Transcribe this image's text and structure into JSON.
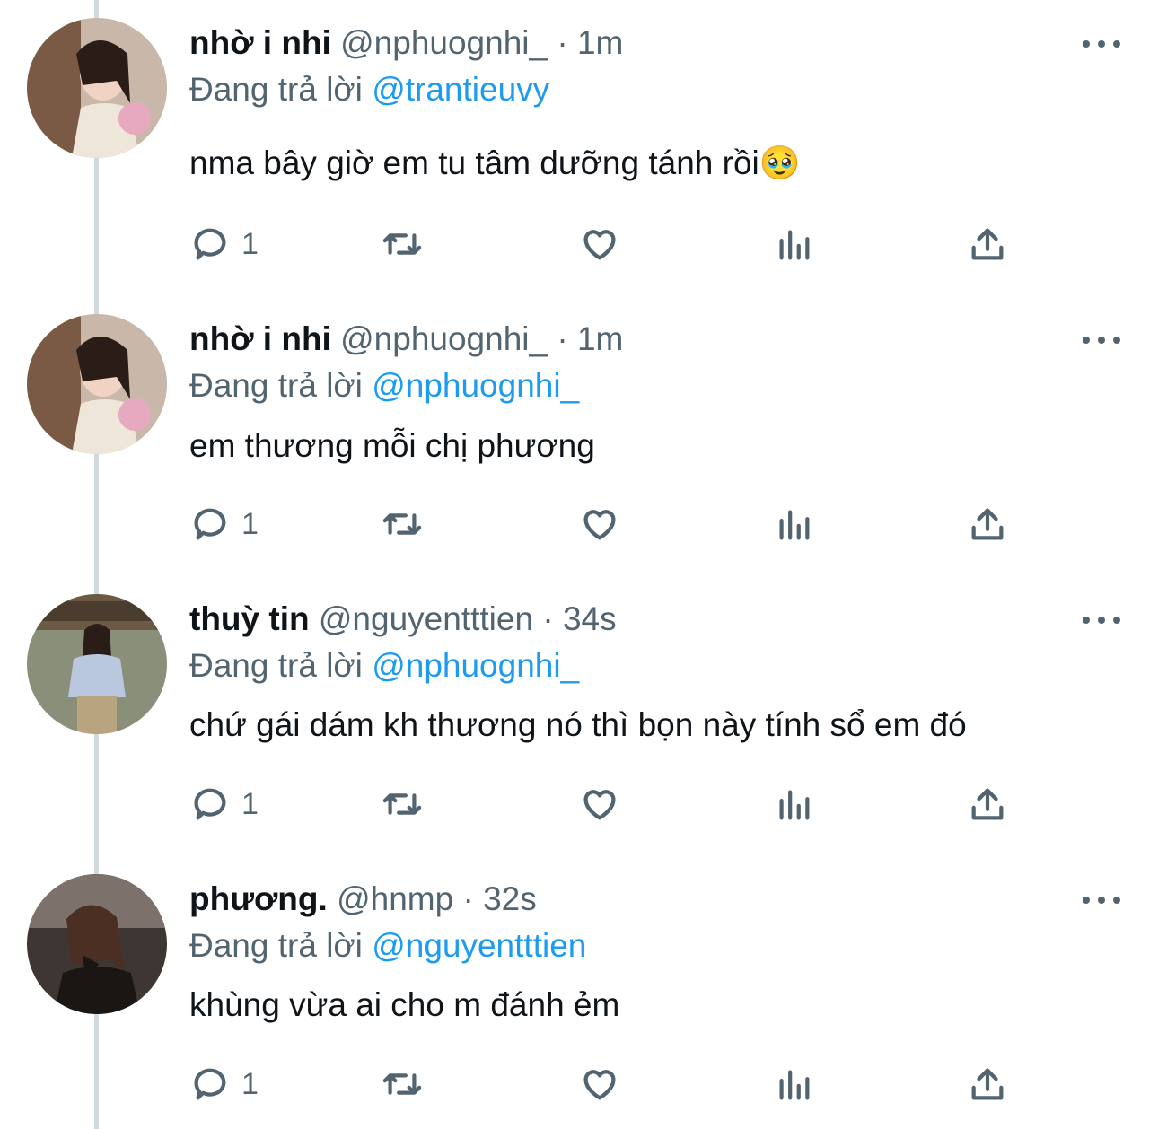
{
  "reply_prefix": "Đang trả lời",
  "tweets": [
    {
      "name": "nhờ i nhi",
      "handle": "@nphuognhi_",
      "dot": "·",
      "time": "1m",
      "reply_to": "@trantieuvy",
      "text": "nma bây giờ em tu tâm dưỡng tánh rồi🥹",
      "reply_count": "1"
    },
    {
      "name": "nhờ i nhi",
      "handle": "@nphuognhi_",
      "dot": "·",
      "time": "1m",
      "reply_to": "@nphuognhi_",
      "text": "em thương mỗi chị phương",
      "reply_count": "1"
    },
    {
      "name": "thuỳ tin",
      "handle": "@nguyentttien",
      "dot": "·",
      "time": "34s",
      "reply_to": "@nphuognhi_",
      "text": "chứ gái dám kh thương nó thì bọn này tính sổ em đó",
      "reply_count": "1"
    },
    {
      "name": "phương.",
      "handle": "@hnmp",
      "dot": "·",
      "time": "32s",
      "reply_to": "@nguyentttien",
      "text": "khùng vừa ai cho m đánh ẻm",
      "reply_count": "1"
    }
  ],
  "icons": {
    "reply": "reply-icon",
    "retweet": "retweet-icon",
    "like": "heart-icon",
    "views": "analytics-icon",
    "share": "share-icon",
    "more": "more-icon"
  },
  "colors": {
    "link": "#1d9bf0",
    "muted": "#536471",
    "text": "#0f1419",
    "thread_line": "#cfd9de"
  }
}
